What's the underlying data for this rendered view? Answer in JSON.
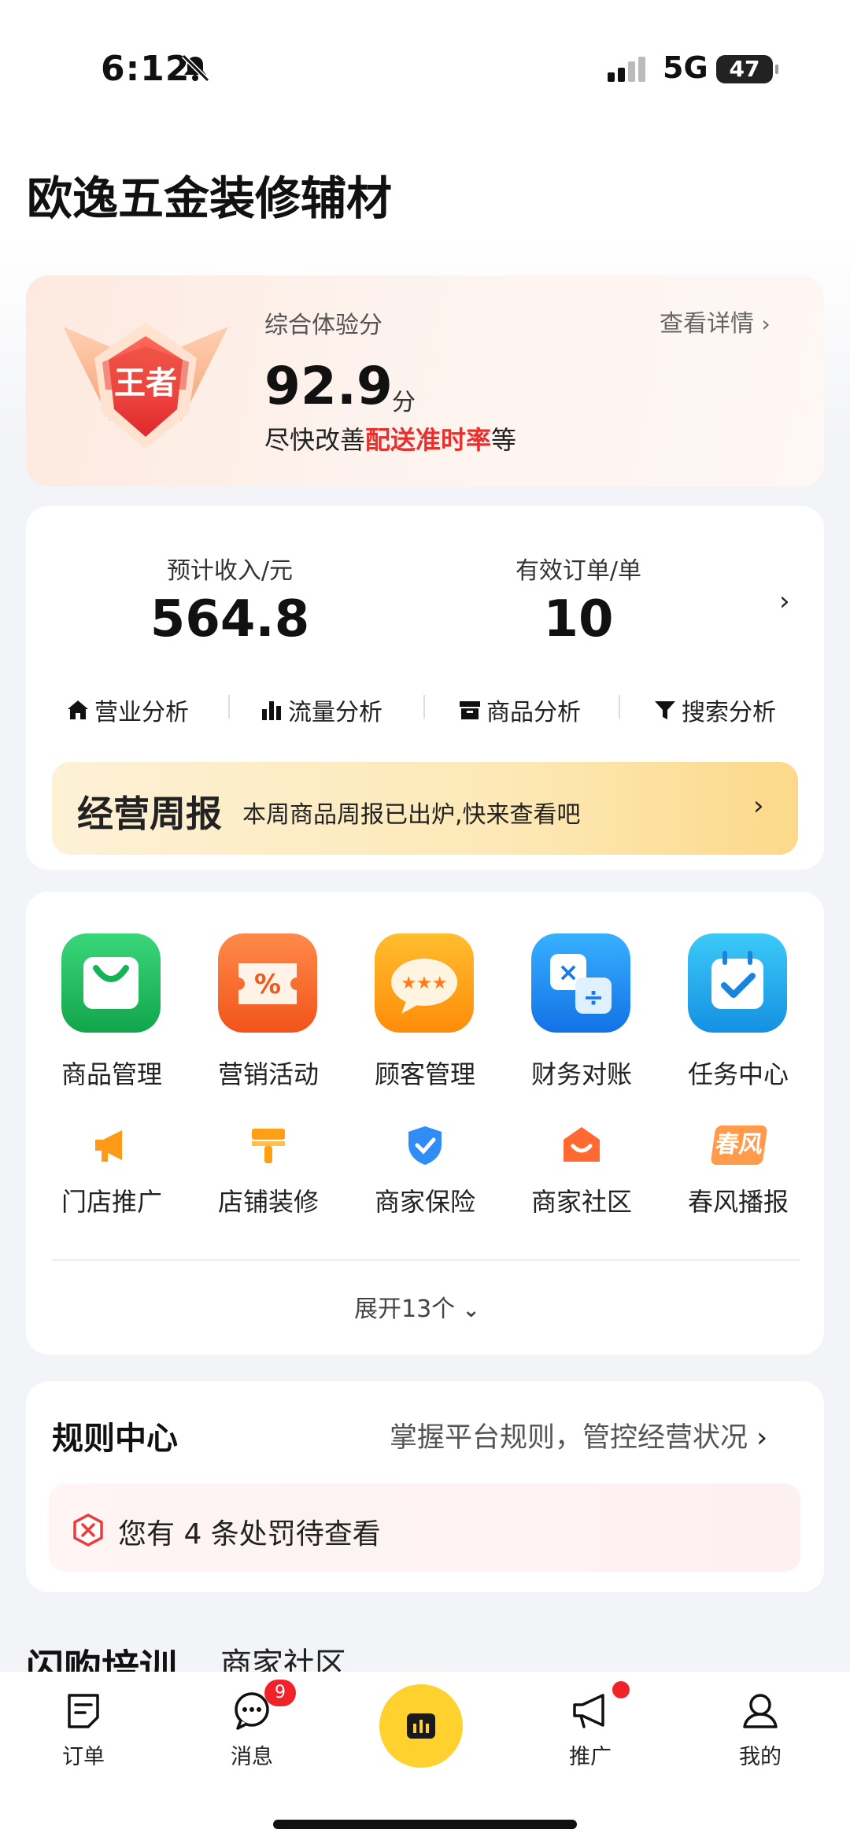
{
  "status_bar": {
    "time": "6:12",
    "network": "5G",
    "battery": "47"
  },
  "shop_name": "欧逸五金装修辅材",
  "score_card": {
    "badge_text": "王者",
    "label": "综合体验分",
    "detail_link": "查看详情",
    "score": "92.9",
    "unit": "分",
    "hint_prefix": "尽快改善",
    "hint_highlight": "配送准时率",
    "hint_suffix": "等"
  },
  "stats": {
    "income_label": "预计收入/元",
    "income_value": "564.8",
    "orders_label": "有效订单/单",
    "orders_value": "10"
  },
  "analysis": [
    {
      "label": "营业分析",
      "icon": "home-icon"
    },
    {
      "label": "流量分析",
      "icon": "bar-chart-icon"
    },
    {
      "label": "商品分析",
      "icon": "box-icon"
    },
    {
      "label": "搜索分析",
      "icon": "filter-icon"
    }
  ],
  "weekly_report": {
    "title": "经营周报",
    "subtitle": "本周商品周报已出炉,快来查看吧"
  },
  "main_tools": [
    {
      "label": "商品管理",
      "icon": "shopping-bag-icon",
      "color": "#1fbf5f"
    },
    {
      "label": "营销活动",
      "icon": "coupon-icon",
      "color": "#ff6a2b"
    },
    {
      "label": "顾客管理",
      "icon": "chat-bubble-icon",
      "color": "#ff9a12"
    },
    {
      "label": "财务对账",
      "icon": "calculator-icon",
      "color": "#1c8cf0"
    },
    {
      "label": "任务中心",
      "icon": "calendar-check-icon",
      "color": "#1aa8ee"
    }
  ],
  "sub_tools": [
    {
      "label": "门店推广",
      "icon": "megaphone-icon"
    },
    {
      "label": "店铺装修",
      "icon": "paint-brush-icon"
    },
    {
      "label": "商家保险",
      "icon": "shield-check-icon"
    },
    {
      "label": "商家社区",
      "icon": "community-icon"
    },
    {
      "label": "春风播报",
      "icon": "spring-news-icon",
      "icon_text": "春风"
    }
  ],
  "expand_label": "展开13个",
  "rules": {
    "title": "规则中心",
    "subtitle": "掌握平台规则，管控经营状况",
    "penalty_text": "您有 4 条处罚待查看"
  },
  "bottom_tabs": [
    "闪购培训",
    "商家社区"
  ],
  "nav": [
    {
      "label": "订单",
      "icon": "order-icon"
    },
    {
      "label": "消息",
      "icon": "message-icon",
      "badge": "9"
    },
    {
      "label": "",
      "icon": "dashboard-icon"
    },
    {
      "label": "推广",
      "icon": "megaphone-outline-icon"
    },
    {
      "label": "我的",
      "icon": "user-icon"
    }
  ],
  "colors": {
    "accent_yellow": "#ffd12e",
    "accent_red": "#e8302e"
  }
}
